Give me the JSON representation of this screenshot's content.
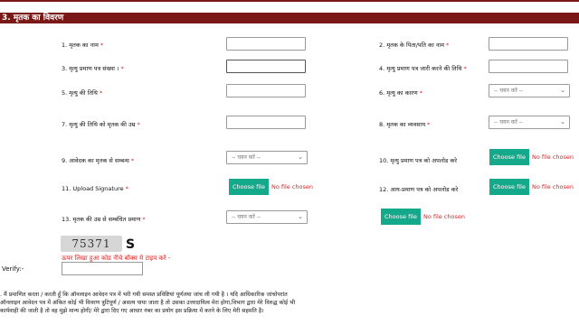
{
  "section": {
    "title": "3. मृतक का विवरण"
  },
  "fields": {
    "f1": {
      "label": "1. मृतक का नाम",
      "required": "*"
    },
    "f2": {
      "label": "2. मृतक के पिता/पति का नाम",
      "required": "*"
    },
    "f3": {
      "label": "3. मृत्यु प्रमाण पत्र संख्या ।",
      "required": "*"
    },
    "f4": {
      "label": "4. मृत्यु प्रमाण पत्र जारी करने की तिथि",
      "required": "*"
    },
    "f5": {
      "label": "5. मृत्यु की तिथि",
      "required": "*"
    },
    "f6": {
      "label": "6. मृत्यु का कारण",
      "required": "*",
      "select": "-- चयन करें --"
    },
    "f7": {
      "label": "7. मृत्यु की तिथि को मृतक की उम्र",
      "required": "*"
    },
    "f8": {
      "label": "8. मृतक का व्यवसाय",
      "required": "*",
      "select": "-- चयन करें --"
    },
    "f9": {
      "label": "9. आवेदक का मृतक से सम्बन्ध",
      "required": "*",
      "select": "-- चयन करें --"
    },
    "f10": {
      "label": "10. मृत्यु प्रमाण पत्र को अपलोड करे",
      "upload": "Choose file",
      "nofile": "No file chosen"
    },
    "f11": {
      "label": "11. Upload Signature",
      "required": "*",
      "upload": "Choose file",
      "nofile": "No file chosen"
    },
    "f12": {
      "label": "12. आय-प्रमाण पत्र को अपलोड करे",
      "upload": "Choose file",
      "nofile": "No file chosen"
    },
    "f13": {
      "label": "13. मृतक की उम्र से सम्बंधित प्रमाण",
      "required": "*",
      "select": "-- चयन करें --",
      "upload": "Choose file",
      "nofile": "No file chosen"
    }
  },
  "captcha": {
    "code": "75371",
    "hint": "ऊपर लिखा हुआ कोड नीचे बॉक्स मे टाइप करे -"
  },
  "verify": {
    "label": "Verify:-"
  },
  "declaration": {
    "line1": ". मैं प्रमाणित करता / करती हूँ कि ऑनलाइन आवेदन पत्र में भरी गयी समस्त प्रविष्टियां पूर्णतया जांच ली गयी है । यदि आधिकारिक जांचोपरांत",
    "line2": "ऑनलाइन आवेदन पत्र में अंकित कोई भी विवरण त्रुटिपूर्ण / असत्य पाया जाता है तो उसका उत्तरदायित्व मेरा होगा,विभाग द्वारा मेरे विरुद्ध कोई भी",
    "line3": "कार्यवाही की जाती है तो वह मुझे मान्य होगी/ मेरे द्वारा दिए गए आधार नंबर का प्रयोग इस प्रक्रिया में करने के लिए मेरी सहमति है।"
  },
  "colors": {
    "header_bg": "#7a1818",
    "upload_btn": "#14a98b",
    "required": "#dd2222"
  }
}
